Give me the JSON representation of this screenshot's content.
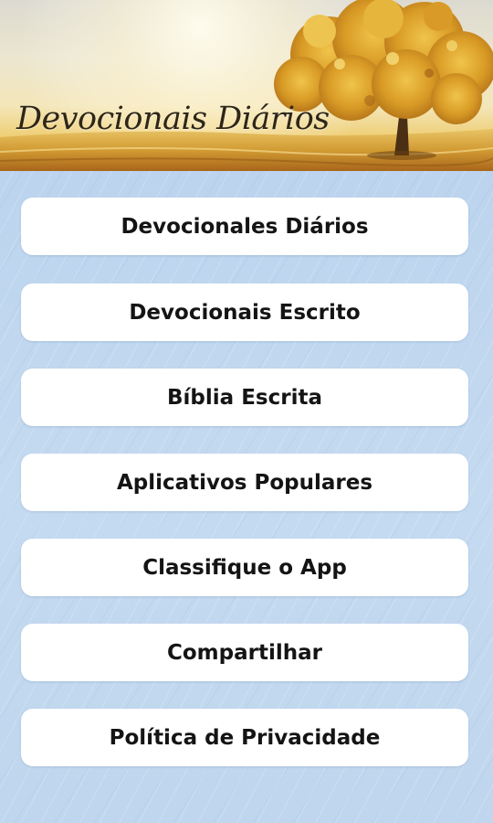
{
  "header": {
    "title": "Devocionais Diários",
    "image_icon": "autumn-tree-field-banner"
  },
  "menu": {
    "items": [
      {
        "label": "Devocionales Diários"
      },
      {
        "label": "Devocionais Escrito"
      },
      {
        "label": "Bíblia Escrita"
      },
      {
        "label": "Aplicativos Populares"
      },
      {
        "label": "Classifique o App"
      },
      {
        "label": "Compartilhar"
      },
      {
        "label": "Política de Privacidade"
      }
    ]
  },
  "colors": {
    "background": "#c3d9ef",
    "button": "#ffffff",
    "button_text": "#141414",
    "title_text": "#2e2617"
  }
}
